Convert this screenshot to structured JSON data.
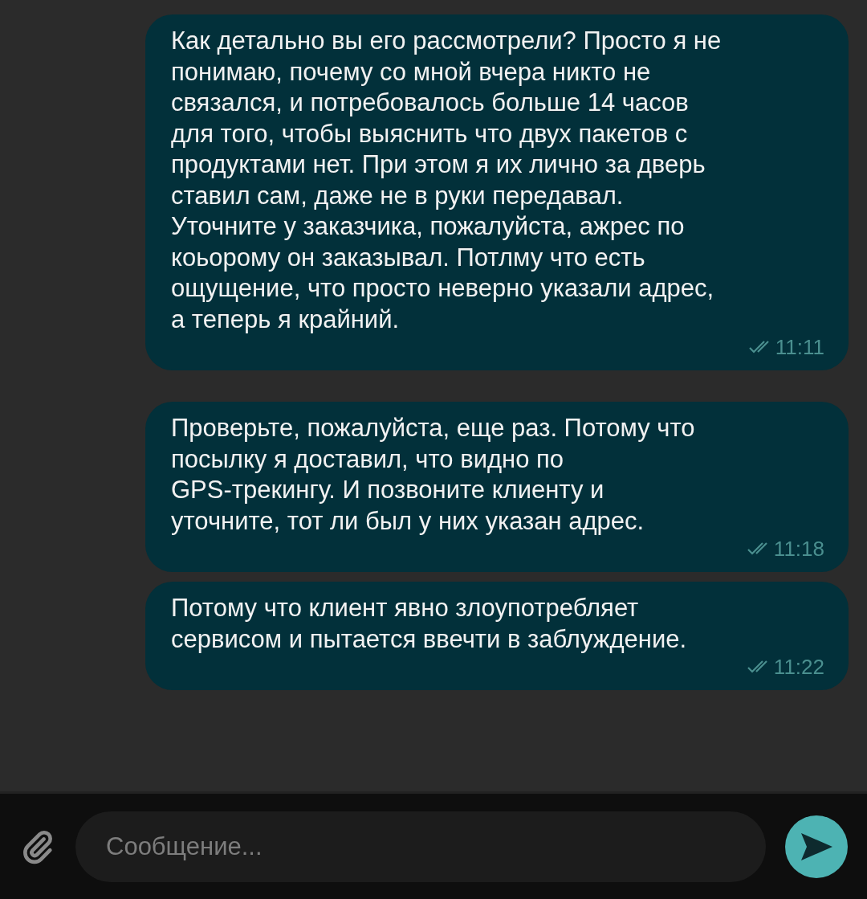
{
  "messages": [
    {
      "text": "Как детально вы его рассмотрели? Просто я не\nпонимаю, почему со мной вчера никто не\nсвязался, и потребовалось больше 14 часов\nдля того, чтобы выяснить что двух пакетов с\nпродуктами нет. При этом я их лично за дверь\nставил сам, даже не в руки передавал.\nУточните у заказчика, пожалуйста, ажрес по\nкоьорому он заказывал. Потлму что есть\nощущение, что просто неверно указали адрес,\nа теперь я крайний.",
      "time": "11:11",
      "read": true
    },
    {
      "text": "Проверьте, пожалуйста, еще раз. Потому что\nпосылку я доставил, что видно по\nGPS-трекингу. И позвоните клиенту и\nуточните, тот ли был у них указан адрес.",
      "time": "11:18",
      "read": true
    },
    {
      "text": "Потому что клиент явно злоупотребляет\nсервисом и пытается ввечти в заблуждение.",
      "time": "11:22",
      "read": true
    }
  ],
  "composer": {
    "placeholder": "Сообщение..."
  }
}
